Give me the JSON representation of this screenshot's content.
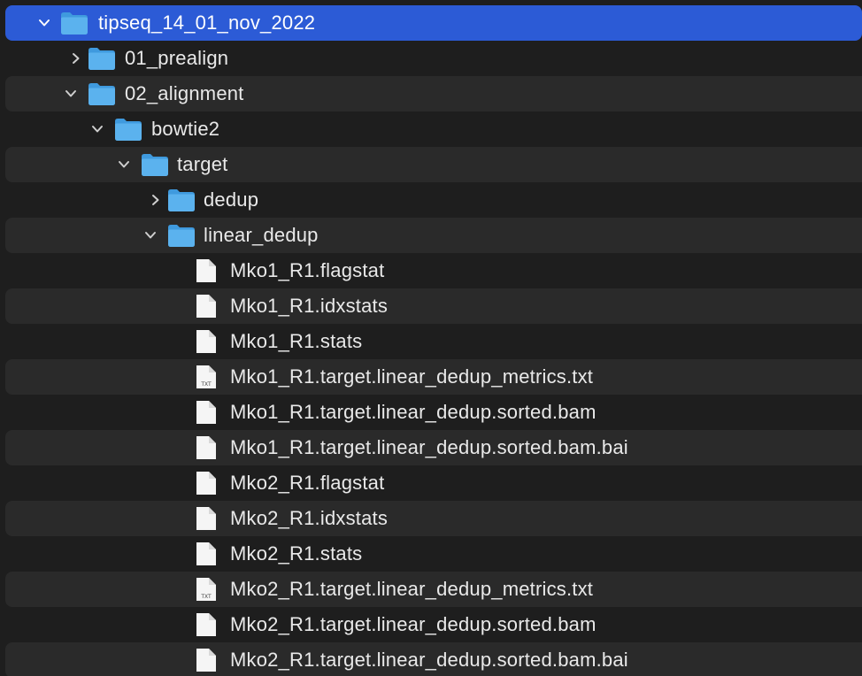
{
  "colors": {
    "background": "#1e1e1e",
    "alt_row": "#2a2a2a",
    "selection": "#2c5bd6",
    "folder_body": "#5bb2ee",
    "folder_tab": "#3f9ade",
    "file_page": "#f5f5f5",
    "text": "#e9e9e9"
  },
  "rows": [
    {
      "id": "tipseq",
      "label": "tipseq_14_01_nov_2022",
      "kind": "folder",
      "expanded": true,
      "selected": true
    },
    {
      "id": "prealign",
      "label": "01_prealign",
      "kind": "folder",
      "expanded": false
    },
    {
      "id": "alignment",
      "label": "02_alignment",
      "kind": "folder",
      "expanded": true
    },
    {
      "id": "bowtie2",
      "label": "bowtie2",
      "kind": "folder",
      "expanded": true
    },
    {
      "id": "target",
      "label": "target",
      "kind": "folder",
      "expanded": true
    },
    {
      "id": "dedup",
      "label": "dedup",
      "kind": "folder",
      "expanded": false
    },
    {
      "id": "linear-dedup",
      "label": "linear_dedup",
      "kind": "folder",
      "expanded": true
    },
    {
      "id": "f1",
      "label": "Mko1_R1.flagstat",
      "kind": "file"
    },
    {
      "id": "f2",
      "label": "Mko1_R1.idxstats",
      "kind": "file"
    },
    {
      "id": "f3",
      "label": "Mko1_R1.stats",
      "kind": "file"
    },
    {
      "id": "f4",
      "label": "Mko1_R1.target.linear_dedup_metrics.txt",
      "kind": "txt",
      "badge": "TXT"
    },
    {
      "id": "f5",
      "label": "Mko1_R1.target.linear_dedup.sorted.bam",
      "kind": "file"
    },
    {
      "id": "f6",
      "label": "Mko1_R1.target.linear_dedup.sorted.bam.bai",
      "kind": "file"
    },
    {
      "id": "f7",
      "label": "Mko2_R1.flagstat",
      "kind": "file"
    },
    {
      "id": "f8",
      "label": "Mko2_R1.idxstats",
      "kind": "file"
    },
    {
      "id": "f9",
      "label": "Mko2_R1.stats",
      "kind": "file"
    },
    {
      "id": "f10",
      "label": "Mko2_R1.target.linear_dedup_metrics.txt",
      "kind": "txt",
      "badge": "TXT"
    },
    {
      "id": "f11",
      "label": "Mko2_R1.target.linear_dedup.sorted.bam",
      "kind": "file"
    },
    {
      "id": "f12",
      "label": "Mko2_R1.target.linear_dedup.sorted.bam.bai",
      "kind": "file"
    }
  ]
}
